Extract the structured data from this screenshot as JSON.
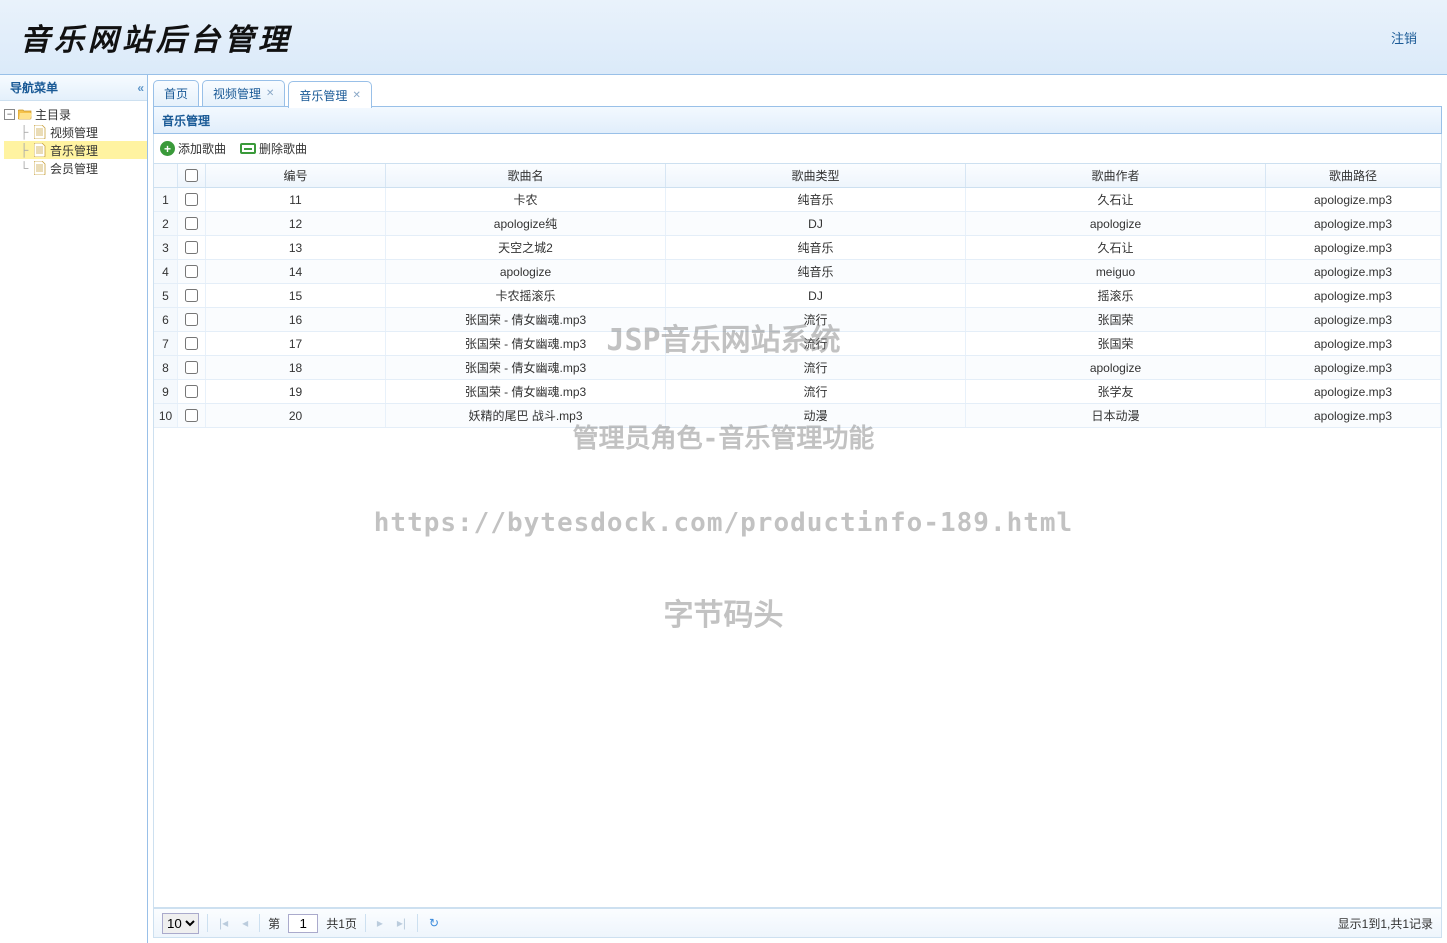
{
  "header": {
    "title": "音乐网站后台管理",
    "logout": "注销"
  },
  "sidebar": {
    "title": "导航菜单",
    "root": "主目录",
    "items": [
      {
        "label": "视频管理"
      },
      {
        "label": "音乐管理",
        "selected": true
      },
      {
        "label": "会员管理"
      }
    ]
  },
  "tabs": [
    {
      "label": "首页",
      "closable": false
    },
    {
      "label": "视频管理",
      "closable": true
    },
    {
      "label": "音乐管理",
      "closable": true,
      "active": true
    }
  ],
  "panel": {
    "title": "音乐管理",
    "toolbar": {
      "add": "添加歌曲",
      "del": "删除歌曲"
    },
    "columns": [
      "编号",
      "歌曲名",
      "歌曲类型",
      "歌曲作者",
      "歌曲路径"
    ],
    "rows": [
      {
        "n": 1,
        "id": "11",
        "name": "卡农",
        "type": "纯音乐",
        "author": "久石让",
        "path": "apologize.mp3"
      },
      {
        "n": 2,
        "id": "12",
        "name": "apologize纯",
        "type": "DJ",
        "author": "apologize",
        "path": "apologize.mp3"
      },
      {
        "n": 3,
        "id": "13",
        "name": "天空之城2",
        "type": "纯音乐",
        "author": "久石让",
        "path": "apologize.mp3"
      },
      {
        "n": 4,
        "id": "14",
        "name": "apologize",
        "type": "纯音乐",
        "author": "meiguo",
        "path": "apologize.mp3"
      },
      {
        "n": 5,
        "id": "15",
        "name": "卡农摇滚乐",
        "type": "DJ",
        "author": "摇滚乐",
        "path": "apologize.mp3"
      },
      {
        "n": 6,
        "id": "16",
        "name": "张国荣 - 倩女幽魂.mp3",
        "type": "流行",
        "author": "张国荣",
        "path": "apologize.mp3"
      },
      {
        "n": 7,
        "id": "17",
        "name": "张国荣 - 倩女幽魂.mp3",
        "type": "流行",
        "author": "张国荣",
        "path": "apologize.mp3"
      },
      {
        "n": 8,
        "id": "18",
        "name": "张国荣 - 倩女幽魂.mp3",
        "type": "流行",
        "author": "apologize",
        "path": "apologize.mp3"
      },
      {
        "n": 9,
        "id": "19",
        "name": "张国荣 - 倩女幽魂.mp3",
        "type": "流行",
        "author": "张学友",
        "path": "apologize.mp3"
      },
      {
        "n": 10,
        "id": "20",
        "name": "妖精的尾巴 战斗.mp3",
        "type": "动漫",
        "author": "日本动漫",
        "path": "apologize.mp3"
      }
    ]
  },
  "pager": {
    "pagesize": "10",
    "page_label_prefix": "第",
    "page_current": "1",
    "total_pages_label": "共1页",
    "info": "显示1到1,共1记录"
  },
  "watermark": {
    "line1": "JSP音乐网站系统",
    "line2": "管理员角色-音乐管理功能",
    "line3": "https://bytesdock.com/productinfo-189.html",
    "line4": "字节码头"
  }
}
